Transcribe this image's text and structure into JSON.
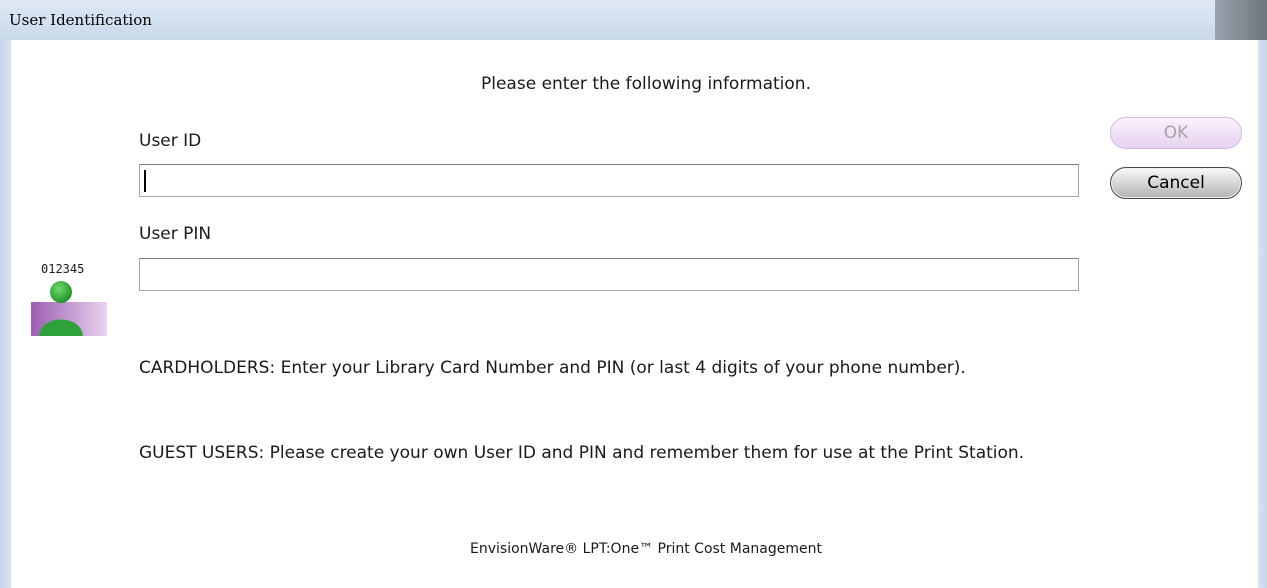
{
  "window": {
    "title": "User Identification"
  },
  "form": {
    "instructions": "Please enter the following information.",
    "user_id_label": "User ID",
    "user_id_value": "",
    "user_pin_label": "User PIN",
    "user_pin_value": ""
  },
  "buttons": {
    "ok_label": "OK",
    "cancel_label": "Cancel"
  },
  "icon": {
    "name": "user-card-icon",
    "digits": "012345",
    "colors": {
      "person": "#2fa13a",
      "card": "#b47ec4"
    }
  },
  "notes": {
    "cardholders": "CARDHOLDERS: Enter your Library Card Number and PIN (or last 4 digits of your phone number).",
    "guests": "GUEST USERS: Please create your own User ID and PIN and remember them for use at the Print Station."
  },
  "footer": "EnvisionWare® LPT:One™ Print Cost Management"
}
